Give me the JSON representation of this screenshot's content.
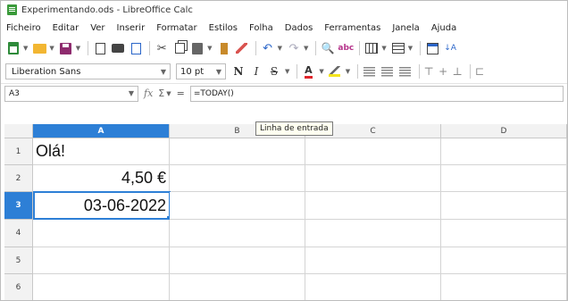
{
  "window": {
    "title": "Experimentando.ods - LibreOffice Calc"
  },
  "menu": [
    "Ficheiro",
    "Editar",
    "Ver",
    "Inserir",
    "Formatar",
    "Estilos",
    "Folha",
    "Dados",
    "Ferramentas",
    "Janela",
    "Ajuda"
  ],
  "toolbar": {
    "icons": [
      "new-icon",
      "open-icon",
      "save-icon",
      "export-pdf-icon",
      "print-icon",
      "print-preview-icon",
      "cut-icon",
      "copy-icon",
      "paste-icon",
      "clone-formatting-icon",
      "clear-formatting-icon",
      "undo-icon",
      "redo-icon",
      "find-replace-icon",
      "spelling-icon",
      "row-icon",
      "column-icon",
      "date-icon",
      "sort-ascending-icon"
    ]
  },
  "format": {
    "font_name": "Liberation Sans",
    "font_size": "10 pt",
    "bold": "N",
    "italic": "I",
    "strike": "S",
    "font_color_glyph": "A",
    "colors": {
      "font": "#e0252b",
      "highlight": "#f5e51c",
      "selection": "#2d7fd6"
    }
  },
  "formula_bar": {
    "name_box": "A3",
    "fx": "fx",
    "sigma": "Σ",
    "equals": "=",
    "content": "=TODAY()"
  },
  "tooltip": "Linha de entrada",
  "sheet": {
    "columns": [
      "A",
      "B",
      "C",
      "D"
    ],
    "rows": [
      "1",
      "2",
      "3",
      "4",
      "5",
      "6"
    ],
    "active_cell": "A3",
    "cells": {
      "A1": "Olá!",
      "A2": "4,50 €",
      "A3": "03-06-2022"
    }
  }
}
